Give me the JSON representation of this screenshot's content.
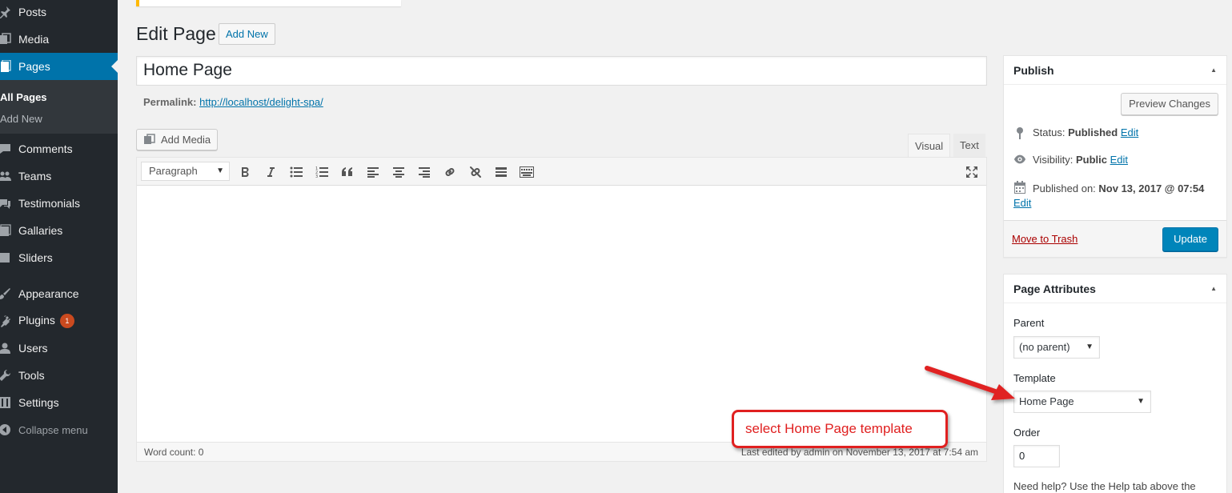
{
  "sidebar": {
    "items": [
      {
        "label": "Posts",
        "icon": "pushpin-icon"
      },
      {
        "label": "Media",
        "icon": "media-icon"
      },
      {
        "label": "Pages",
        "icon": "pages-icon"
      },
      {
        "label": "Comments",
        "icon": "comments-icon"
      },
      {
        "label": "Teams",
        "icon": "groups-icon"
      },
      {
        "label": "Testimonials",
        "icon": "testimonial-icon"
      },
      {
        "label": "Gallaries",
        "icon": "gallery-icon"
      },
      {
        "label": "Sliders",
        "icon": "slider-icon"
      },
      {
        "label": "Appearance",
        "icon": "brush-icon"
      },
      {
        "label": "Plugins",
        "icon": "plugin-icon",
        "badge": "1"
      },
      {
        "label": "Users",
        "icon": "users-icon"
      },
      {
        "label": "Tools",
        "icon": "wrench-icon"
      },
      {
        "label": "Settings",
        "icon": "settings-icon"
      }
    ],
    "submenu": {
      "all_pages": "All Pages",
      "add_new": "Add New"
    },
    "collapse_label": "Collapse menu"
  },
  "header": {
    "title": "Edit Page",
    "add_new_label": "Add New"
  },
  "editor": {
    "title_value": "Home Page",
    "permalink_label": "Permalink:",
    "permalink_url": "http://localhost/delight-spa/",
    "add_media_label": "Add Media",
    "tabs": {
      "visual": "Visual",
      "text": "Text"
    },
    "format_value": "Paragraph",
    "word_count": "Word count: 0",
    "last_edited": "Last edited by admin on November 13, 2017 at 7:54 am"
  },
  "callout": {
    "text": "select Home Page template"
  },
  "publish": {
    "title": "Publish",
    "preview_label": "Preview Changes",
    "status_label": "Status:",
    "status_value": "Published",
    "visibility_label": "Visibility:",
    "visibility_value": "Public",
    "published_label": "Published on:",
    "published_value": "Nov 13, 2017 @ 07:54",
    "edit_label": "Edit",
    "trash_label": "Move to Trash",
    "update_label": "Update"
  },
  "attributes": {
    "title": "Page Attributes",
    "parent_label": "Parent",
    "parent_value": "(no parent)",
    "template_label": "Template",
    "template_value": "Home Page",
    "order_label": "Order",
    "order_value": "0",
    "help_text": "Need help? Use the Help tab above the"
  },
  "colors": {
    "sidebar_bg": "#23282d",
    "accent": "#0073aa",
    "callout": "#e02020",
    "badge": "#ca4a1f"
  }
}
